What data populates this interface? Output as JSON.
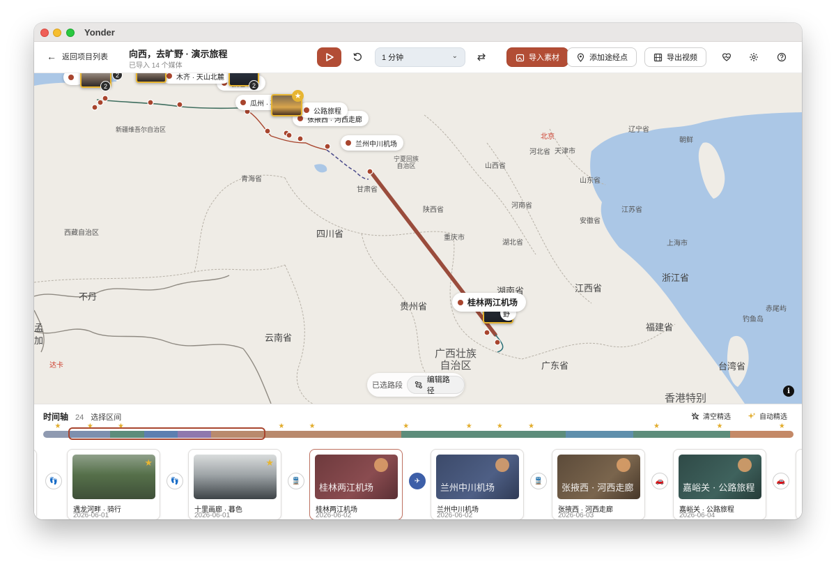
{
  "app": {
    "name": "Yonder"
  },
  "toolbar": {
    "back_label": "返回项目列表",
    "project_title": "向西，去旷野 · 演示旅程",
    "project_subtitle": "已导入 14 个媒体",
    "duration_value": "1 分钟",
    "import_label": "导入素材",
    "add_waypoint_label": "添加途经点",
    "export_label": "导出视频"
  },
  "map": {
    "labels": [
      {
        "text": "西藏自治区",
        "cls": ""
      },
      {
        "text": "青海省",
        "cls": ""
      },
      {
        "text": "甘肃省",
        "cls": ""
      },
      {
        "text": "四川省",
        "cls": "lg"
      },
      {
        "text": "陕西省",
        "cls": ""
      },
      {
        "text": "山西省",
        "cls": ""
      },
      {
        "text": "河北省",
        "cls": ""
      },
      {
        "text": "北京",
        "cls": "red"
      },
      {
        "text": "天津市",
        "cls": ""
      },
      {
        "text": "辽宁省",
        "cls": ""
      },
      {
        "text": "朝鲜",
        "cls": ""
      },
      {
        "text": "山东省",
        "cls": ""
      },
      {
        "text": "河南省",
        "cls": ""
      },
      {
        "text": "江苏省",
        "cls": ""
      },
      {
        "text": "安徽省",
        "cls": ""
      },
      {
        "text": "湖北省",
        "cls": ""
      },
      {
        "text": "重庆市",
        "cls": ""
      },
      {
        "text": "上海市",
        "cls": ""
      },
      {
        "text": "浙江省",
        "cls": "lg"
      },
      {
        "text": "江西省",
        "cls": "lg"
      },
      {
        "text": "湖南省",
        "cls": "lg"
      },
      {
        "text": "贵州省",
        "cls": "lg"
      },
      {
        "text": "云南省",
        "cls": "lg"
      },
      {
        "text": "广西壮族自治区",
        "cls": "xl"
      },
      {
        "text": "广东省",
        "cls": "lg"
      },
      {
        "text": "福建省",
        "cls": "lg"
      },
      {
        "text": "台湾省",
        "cls": "lg"
      },
      {
        "text": "赤尾屿",
        "cls": ""
      },
      {
        "text": "钓鱼岛",
        "cls": ""
      },
      {
        "text": "不丹",
        "cls": "lg"
      },
      {
        "text": "孟加",
        "cls": "lg"
      },
      {
        "text": "达卡",
        "cls": "red"
      },
      {
        "text": "香港特别",
        "cls": "xl"
      },
      {
        "text": "新疆维吾尔自治区",
        "cls": ""
      },
      {
        "text": "宁夏回族自治区",
        "cls": ""
      }
    ],
    "callouts": [
      {
        "text": "兰州中川机场"
      },
      {
        "text": "张掖西 · 河西走廊"
      },
      {
        "text": "公路旅程"
      },
      {
        "text": "瓜州 · 石"
      },
      {
        "text": "敦煌以东"
      },
      {
        "text": "木齐 · 天山北麓"
      },
      {
        "text": "桂林两江机场"
      },
      {
        "text": "野"
      }
    ],
    "cluster_counts": [
      "2",
      "2",
      "2"
    ],
    "selected_segment_label": "已选路段",
    "edit_route_label": "编辑路径",
    "info_label": "i"
  },
  "timeline": {
    "title": "时间轴",
    "count": "24",
    "select_range_label": "选择区间",
    "clear_picks_label": "清空精选",
    "auto_pick_label": "自动精选",
    "segments": [
      {
        "color": "#8f9ab1",
        "weight": 3.5
      },
      {
        "color": "#7d8fae",
        "weight": 5.5
      },
      {
        "color": "#5d8d7b",
        "weight": 4.5
      },
      {
        "color": "#5d7fb0",
        "weight": 4.5
      },
      {
        "color": "#8f78ad",
        "weight": 4.5
      },
      {
        "color": "#b98a6d",
        "weight": 7.5
      },
      {
        "color": "#b98a6d",
        "weight": 18
      },
      {
        "color": "#5d8d7b",
        "weight": 22
      },
      {
        "color": "#5f8fac",
        "weight": 9
      },
      {
        "color": "#5d8d7b",
        "weight": 13
      },
      {
        "color": "#c48967",
        "weight": 8.5
      }
    ],
    "stars": [
      2,
      6.3,
      10.4,
      31.8,
      35.9,
      48.4,
      56.8,
      60.9,
      65.1,
      81.8,
      90.2,
      98.5
    ],
    "cards": [
      {
        "title": "遇龙河畔 · 骑行",
        "date": "2026-06-01",
        "style": "photo-green",
        "starred": true
      },
      {
        "title": "十里画廊 · 暮色",
        "date": "2026-06-01",
        "style": "photo-cloud",
        "starred": true
      },
      {
        "title": "桂林两江机场",
        "date": "2026-06-02",
        "style": "title-red",
        "starred": false,
        "overlay": "桂林两江机场"
      },
      {
        "title": "兰州中川机场",
        "date": "2026-06-02",
        "style": "title-blue",
        "starred": false,
        "overlay": "兰州中川机场"
      },
      {
        "title": "张掖西 · 河西走廊",
        "date": "2026-06-03",
        "style": "title-brown",
        "starred": false,
        "overlay": "张掖西 · 河西走廊"
      },
      {
        "title": "嘉峪关 · 公路旅程",
        "date": "2026-06-04",
        "style": "title-teal",
        "starred": false,
        "overlay": "嘉峪关 · 公路旅程"
      }
    ],
    "connectors": [
      "walk-icon",
      "walk-icon",
      "train-icon",
      "plane-icon",
      "train-icon",
      "car-icon",
      "car-icon"
    ]
  }
}
